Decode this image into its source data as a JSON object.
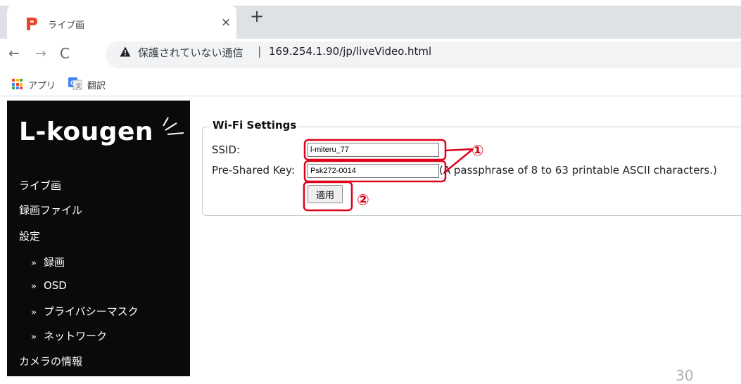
{
  "browser": {
    "tab_title": "ライブ画",
    "tab_close": "×",
    "new_tab": "+",
    "nav_back": "←",
    "nav_forward": "→",
    "nav_reload": "C",
    "security_text": "保護されていない通信",
    "url_separator": "|",
    "url": "169.254.1.90/jp/liveVideo.html",
    "bookmarks": [
      {
        "label": "アプリ",
        "icon": "apps-grid-icon"
      },
      {
        "label": "翻訳",
        "icon": "google-translate-icon"
      }
    ]
  },
  "sidebar": {
    "logo": "L-kougen",
    "items": [
      {
        "label": "ライブ画"
      },
      {
        "label": "録画ファイル"
      },
      {
        "label": "設定"
      },
      {
        "label": "録画",
        "bullet": "»"
      },
      {
        "label": "OSD",
        "bullet": "»"
      },
      {
        "label": "プライバシーマスク",
        "bullet": "»"
      },
      {
        "label": "ネットワーク",
        "bullet": "»"
      },
      {
        "label": "カメラの情報"
      }
    ]
  },
  "wifi": {
    "legend": "Wi-Fi Settings",
    "ssid_label": "SSID:",
    "ssid_value": "l-miteru_77",
    "psk_label": "Pre-Shared Key:",
    "psk_value": "Psk272-0014",
    "psk_hint": "(A passphrase of 8 to 63 printable ASCII characters.)",
    "apply_label": "適用"
  },
  "annotations": {
    "marker_1": "①",
    "marker_2": "②",
    "highlight_color": "#e0001b"
  },
  "colors": {
    "sidebar_bg": "#0a0a0a",
    "tab_strip_bg": "#dee1e6",
    "omnibox_bg": "#f1f3f4"
  },
  "footer": {
    "page_number": "30"
  }
}
